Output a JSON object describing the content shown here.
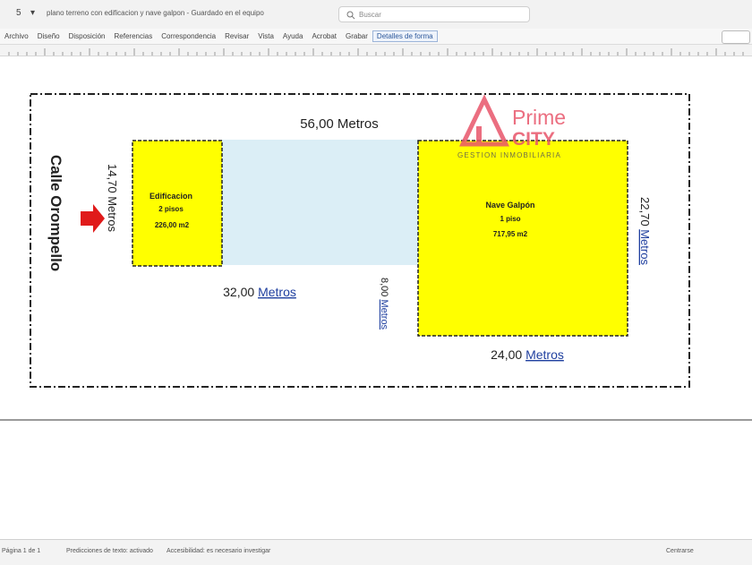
{
  "window": {
    "quick_access": [
      "5",
      "▾"
    ],
    "doc_title": "plano terreno con edificacion y nave galpon - Guardado en el equipo",
    "search_placeholder": "Buscar"
  },
  "ribbon_tabs": [
    "Archivo",
    "Diseño",
    "Disposición",
    "Referencias",
    "Correspondencia",
    "Revisar",
    "Vista",
    "Ayuda",
    "Acrobat",
    "Grabar",
    "Detalles de forma"
  ],
  "plan": {
    "street_label": "Calle Orompello",
    "total_width_label": "56,00 Metros",
    "left_height": {
      "value": "14,70",
      "unit": "Metros"
    },
    "left_width": {
      "value": "32,00",
      "unit": "Metros"
    },
    "connector_height": {
      "value": "8,00",
      "unit": "Metros"
    },
    "right_height": {
      "value": "22,70",
      "unit": "Metros"
    },
    "right_width": {
      "value": "24,00",
      "unit": "Metros"
    },
    "building_left": {
      "line1": "Edificacion",
      "line2": "2 pisos",
      "line3": "226,00 m2"
    },
    "building_right": {
      "line1": "Nave Galpón",
      "line2": "1 piso",
      "line3": "717,95 m2"
    },
    "watermark": {
      "line1": "Prime",
      "line2": "CITY",
      "tagline": "GESTION INMOBILIARIA"
    },
    "colors": {
      "building": "#ffff00",
      "lot": "#dbeef6",
      "arrow": "#e01a1a",
      "watermark": "#e8556a"
    }
  },
  "status": {
    "page": "Página 1 de 1",
    "words": "Predicciones de texto: activado",
    "accessibility": "Accesibilidad: es necesario investigar",
    "focus": "Centrarse"
  }
}
